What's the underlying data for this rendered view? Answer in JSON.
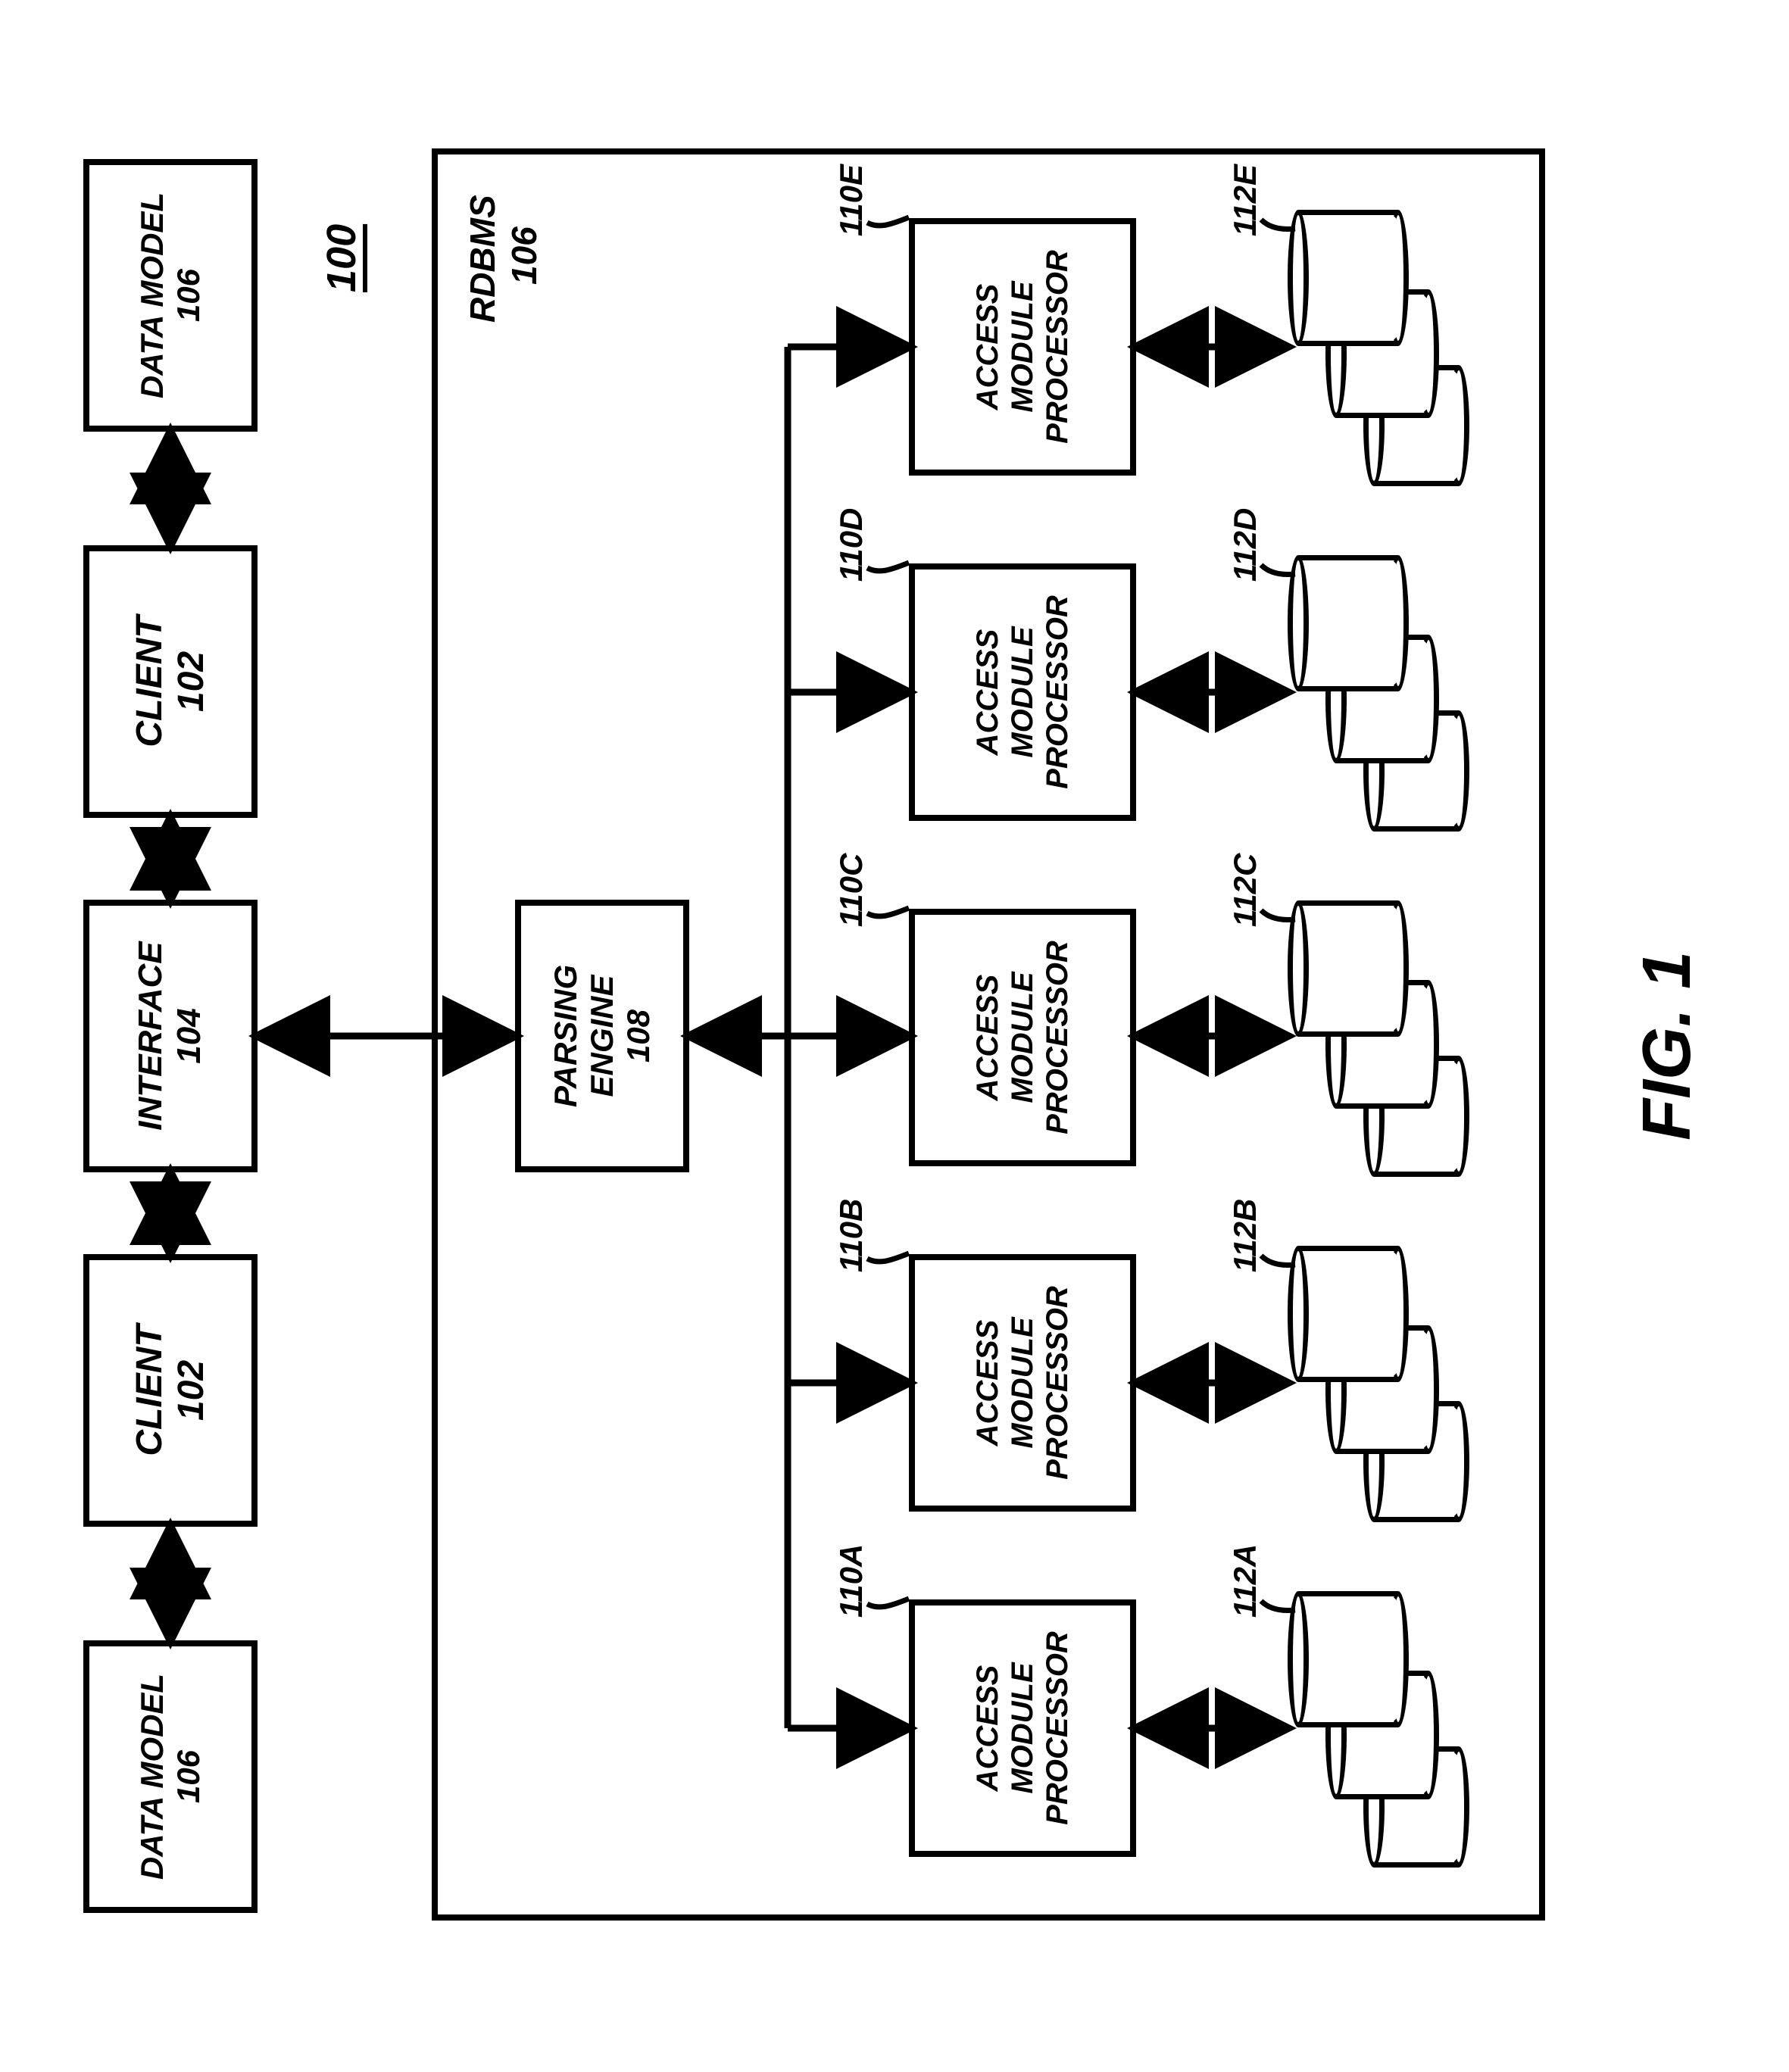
{
  "figure_label": "FIG. 1",
  "system_ref": "100",
  "top": {
    "data_model_left": {
      "title": "DATA MODEL",
      "ref": "106"
    },
    "client_left": {
      "title": "CLIENT",
      "ref": "102"
    },
    "interface": {
      "title": "INTERFACE",
      "ref": "104"
    },
    "client_right": {
      "title": "CLIENT",
      "ref": "102"
    },
    "data_model_right": {
      "title": "DATA MODEL",
      "ref": "106"
    }
  },
  "rdbms": {
    "title": "RDBMS",
    "ref": "106",
    "parsing_engine": {
      "title": "PARSING\nENGINE",
      "ref": "108"
    },
    "amps": [
      {
        "title": "ACCESS\nMODULE\nPROCESSOR",
        "ref": "110A",
        "storage_ref": "112A"
      },
      {
        "title": "ACCESS\nMODULE\nPROCESSOR",
        "ref": "110B",
        "storage_ref": "112B"
      },
      {
        "title": "ACCESS\nMODULE\nPROCESSOR",
        "ref": "110C",
        "storage_ref": "112C"
      },
      {
        "title": "ACCESS\nMODULE\nPROCESSOR",
        "ref": "110D",
        "storage_ref": "112D"
      },
      {
        "title": "ACCESS\nMODULE\nPROCESSOR",
        "ref": "110E",
        "storage_ref": "112E"
      }
    ]
  }
}
